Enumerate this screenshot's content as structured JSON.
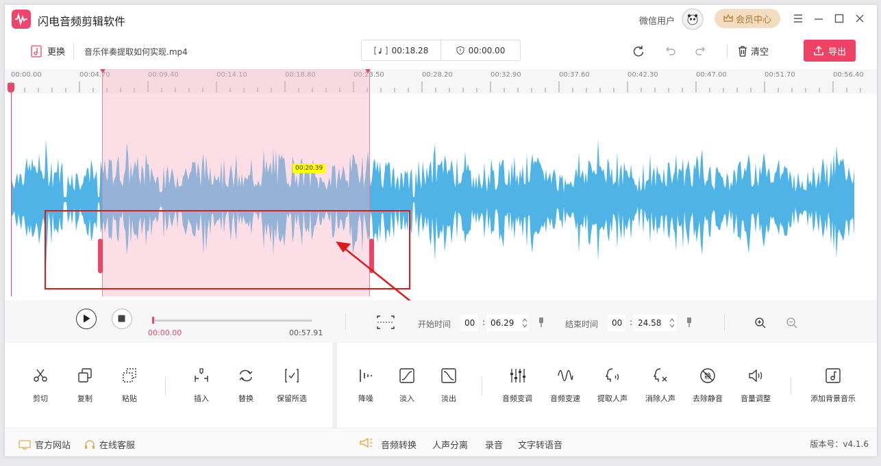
{
  "app": {
    "title": "闪电音频剪辑软件",
    "user_name": "微信用户",
    "vip_label": "会员中心"
  },
  "toolbar": {
    "replace_label": "更换",
    "filename": "音乐伴奏提取如何实现.mp4",
    "duration_time": "00:18.28",
    "position_time": "00:00.00",
    "clear_label": "清空",
    "export_label": "导出"
  },
  "ruler": {
    "ticks": [
      "00:00.00",
      "00:04.70",
      "00:09.40",
      "00:14.10",
      "00:18.80",
      "00:23.50",
      "00:28.20",
      "00:32.90",
      "00:37.60",
      "00:42.30",
      "00:47.00",
      "00:51.70",
      "00:56.40"
    ]
  },
  "selection": {
    "duration_badge": "00:20.39"
  },
  "transport": {
    "current_time": "00:00.00",
    "total_time": "00:57.91",
    "progress": 0.0,
    "start_label": "开始时间",
    "start_min": "00",
    "start_sec": "06.29",
    "end_label": "结束时间",
    "end_min": "00",
    "end_sec": "24.58"
  },
  "tools": {
    "left": [
      {
        "label": "剪切",
        "icon": "scissors-icon"
      },
      {
        "label": "复制",
        "icon": "copy-icon"
      },
      {
        "label": "粘贴",
        "icon": "paste-icon"
      },
      {
        "label": "插入",
        "icon": "insert-icon"
      },
      {
        "label": "替换",
        "icon": "replace-icon"
      },
      {
        "label": "保留所选",
        "icon": "keep-selection-icon"
      }
    ],
    "right": [
      {
        "label": "降噪",
        "icon": "denoise-icon"
      },
      {
        "label": "淡入",
        "icon": "fade-in-icon"
      },
      {
        "label": "淡出",
        "icon": "fade-out-icon"
      },
      {
        "label": "音频变调",
        "icon": "pitch-icon"
      },
      {
        "label": "音频变速",
        "icon": "speed-icon"
      },
      {
        "label": "提取人声",
        "icon": "extract-voice-icon"
      },
      {
        "label": "消除人声",
        "icon": "remove-voice-icon"
      },
      {
        "label": "去除静音",
        "icon": "remove-silence-icon"
      },
      {
        "label": "音量调整",
        "icon": "volume-icon"
      },
      {
        "label": "添加背景音乐",
        "icon": "bg-music-icon"
      }
    ],
    "remove_silence_glyph": "静"
  },
  "footer": {
    "website": "官方网站",
    "support": "在线客服",
    "links": [
      "音频转换",
      "人声分离",
      "录音",
      "文字转语音"
    ],
    "version": "版本号：v4.1.6"
  },
  "colors": {
    "accent": "#f04265",
    "wave": "#4fb3e6",
    "selection": "#f7b2c4",
    "annotation": "#e01818"
  }
}
